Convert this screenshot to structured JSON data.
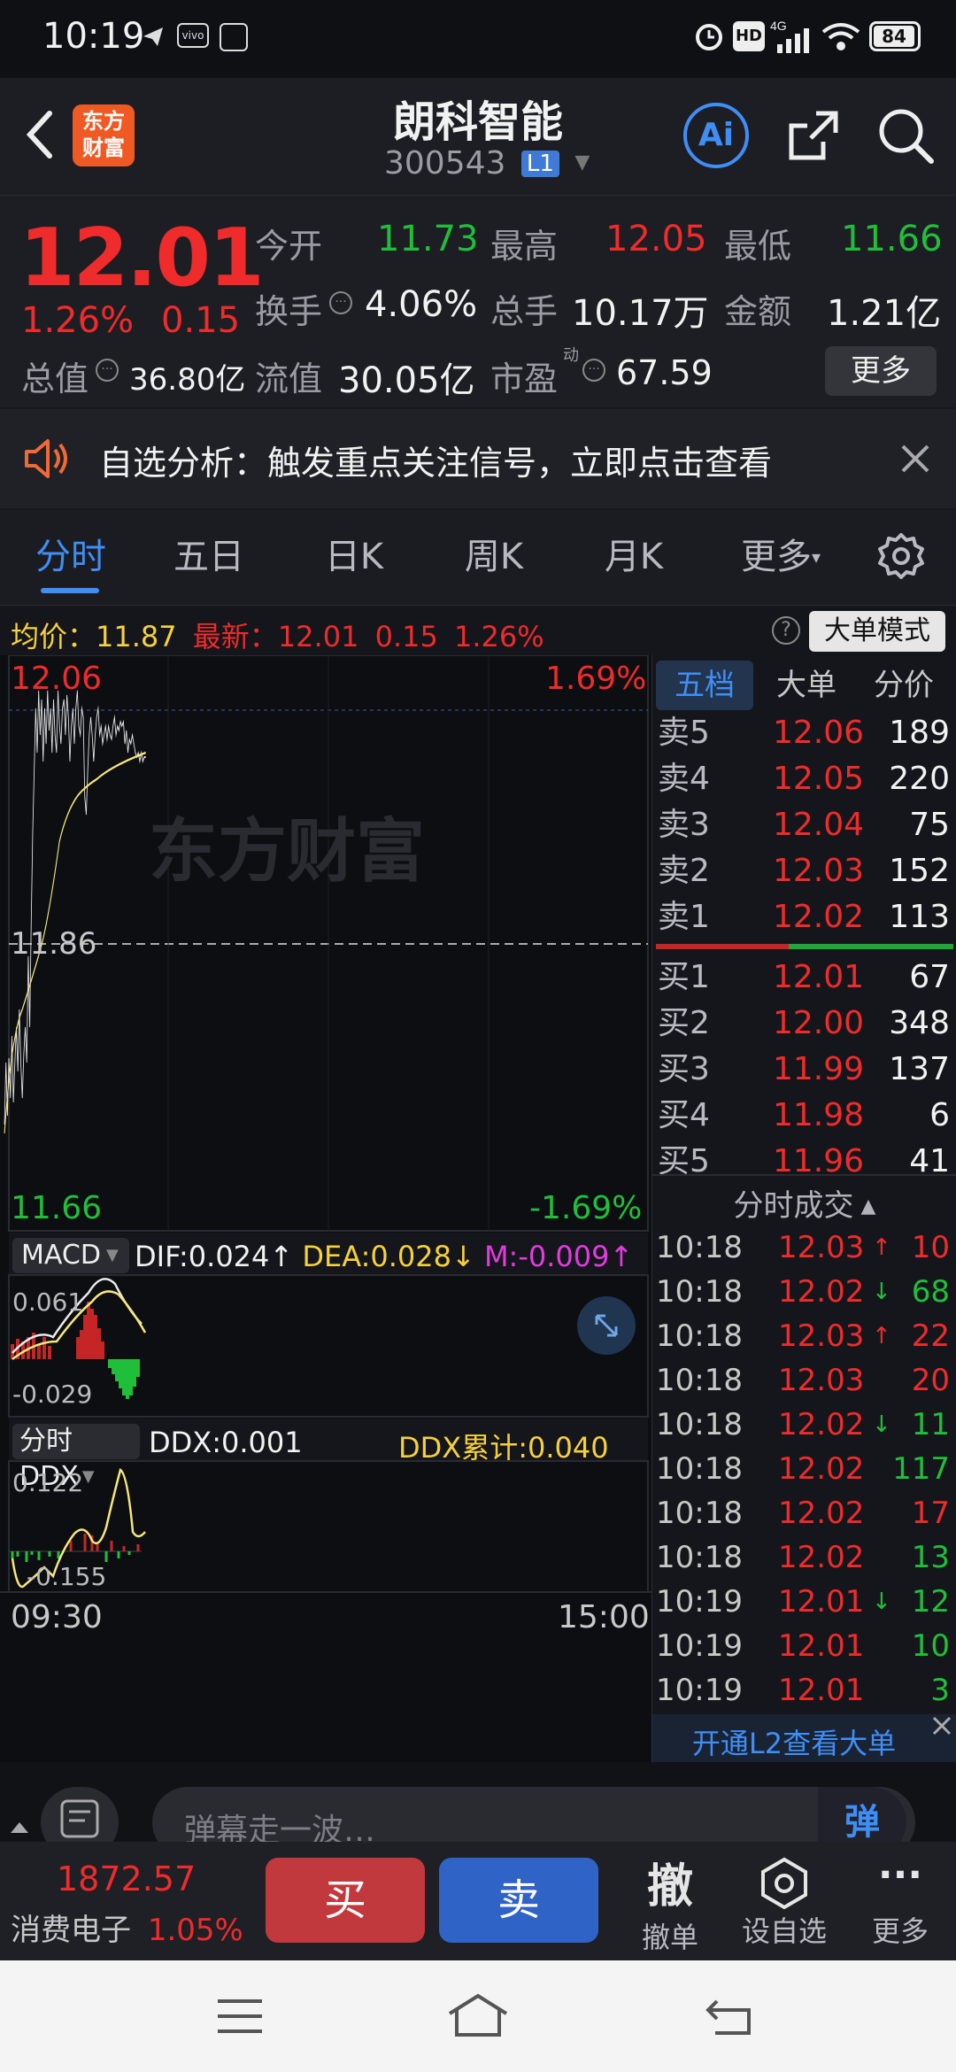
{
  "status_bar": {
    "time": "10:19",
    "battery": "84",
    "signal": "4G"
  },
  "header": {
    "title": "朗科智能",
    "code": "300543",
    "level": "L1",
    "logo_line1": "东方",
    "logo_line2": "财富",
    "ai_label": "Ai"
  },
  "quote": {
    "price": "12.01",
    "change_pct": "1.26%",
    "change": "0.15",
    "open_label": "今开",
    "open": "11.73",
    "high_label": "最高",
    "high": "12.05",
    "low_label": "最低",
    "low": "11.66",
    "turnover_label": "换手",
    "turnover": "4.06%",
    "volume_label": "总手",
    "volume": "10.17万",
    "amount_label": "金额",
    "amount": "1.21亿",
    "total_cap_label": "总值",
    "total_cap": "36.80亿",
    "float_cap_label": "流值",
    "float_cap": "30.05亿",
    "pe_label": "市盈",
    "pe_sup": "动",
    "pe": "67.59",
    "more_label": "更多"
  },
  "notice": {
    "text": "自选分析：触发重点关注信号，立即点击查看"
  },
  "tabs": [
    "分时",
    "五日",
    "日K",
    "周K",
    "月K",
    "更多"
  ],
  "avg_bar": {
    "avg_label": "均价：",
    "avg": "11.87",
    "latest_label": "最新：",
    "latest": "12.01",
    "change": "0.15",
    "change_pct": "1.26%",
    "mode_label": "大单模式"
  },
  "intraday": {
    "top_price": "12.06",
    "top_pct": "1.69%",
    "mid_price": "11.86",
    "bottom_price": "11.66",
    "bottom_pct": "-1.69%",
    "watermark": "东方财富",
    "start_time": "09:30",
    "end_time": "15:00"
  },
  "macd": {
    "label": "MACD",
    "dif": "DIF:0.024",
    "dea": "DEA:0.028",
    "m": "M:-0.009",
    "top": "0.061",
    "bottom": "-0.029"
  },
  "ddx": {
    "label": "分时DDX",
    "ddx": "DDX:0.001",
    "ddx_total": "DDX累计:0.040",
    "top": "0.122",
    "bottom": "-0.155"
  },
  "orderbook": {
    "tabs": [
      "五档",
      "大单",
      "分价"
    ],
    "asks": [
      {
        "label": "卖5",
        "price": "12.06",
        "vol": "189"
      },
      {
        "label": "卖4",
        "price": "12.05",
        "vol": "220"
      },
      {
        "label": "卖3",
        "price": "12.04",
        "vol": "75"
      },
      {
        "label": "卖2",
        "price": "12.03",
        "vol": "152"
      },
      {
        "label": "卖1",
        "price": "12.02",
        "vol": "113"
      }
    ],
    "bids": [
      {
        "label": "买1",
        "price": "12.01",
        "vol": "67"
      },
      {
        "label": "买2",
        "price": "12.00",
        "vol": "348"
      },
      {
        "label": "买3",
        "price": "11.99",
        "vol": "137"
      },
      {
        "label": "买4",
        "price": "11.98",
        "vol": "6"
      },
      {
        "label": "买5",
        "price": "11.96",
        "vol": "41"
      }
    ],
    "trades_title": "分时成交",
    "trades": [
      {
        "time": "10:18",
        "price": "12.03",
        "arrow": "↑",
        "vol": "10",
        "dir": "up"
      },
      {
        "time": "10:18",
        "price": "12.02",
        "arrow": "↓",
        "vol": "68",
        "dir": "down"
      },
      {
        "time": "10:18",
        "price": "12.03",
        "arrow": "↑",
        "vol": "22",
        "dir": "up"
      },
      {
        "time": "10:18",
        "price": "12.03",
        "arrow": "",
        "vol": "20",
        "dir": "up"
      },
      {
        "time": "10:18",
        "price": "12.02",
        "arrow": "↓",
        "vol": "11",
        "dir": "down"
      },
      {
        "time": "10:18",
        "price": "12.02",
        "arrow": "",
        "vol": "117",
        "dir": "down"
      },
      {
        "time": "10:18",
        "price": "12.02",
        "arrow": "",
        "vol": "17",
        "dir": "up"
      },
      {
        "time": "10:18",
        "price": "12.02",
        "arrow": "",
        "vol": "13",
        "dir": "down"
      },
      {
        "time": "10:19",
        "price": "12.01",
        "arrow": "↓",
        "vol": "12",
        "dir": "down"
      },
      {
        "time": "10:19",
        "price": "12.01",
        "arrow": "",
        "vol": "10",
        "dir": "down"
      },
      {
        "time": "10:19",
        "price": "12.01",
        "arrow": "",
        "vol": "3",
        "dir": "down"
      }
    ],
    "l2_banner": "开通L2查看大单"
  },
  "comment": {
    "placeholder": "弹幕走一波…",
    "send_icon_text": "弹"
  },
  "action_bar": {
    "index_value": "1872.57",
    "index_name": "消费电子",
    "index_pct": "1.05%",
    "buy_label": "买",
    "sell_label": "卖",
    "cancel_icon_text": "撤",
    "cancel_label": "撤单",
    "watch_label": "设自选",
    "more_label": "更多"
  },
  "colors": {
    "up": "#ef2b2b",
    "down": "#1fbf3a",
    "accent": "#3f8ef5",
    "avg_line": "#f5e87a"
  }
}
